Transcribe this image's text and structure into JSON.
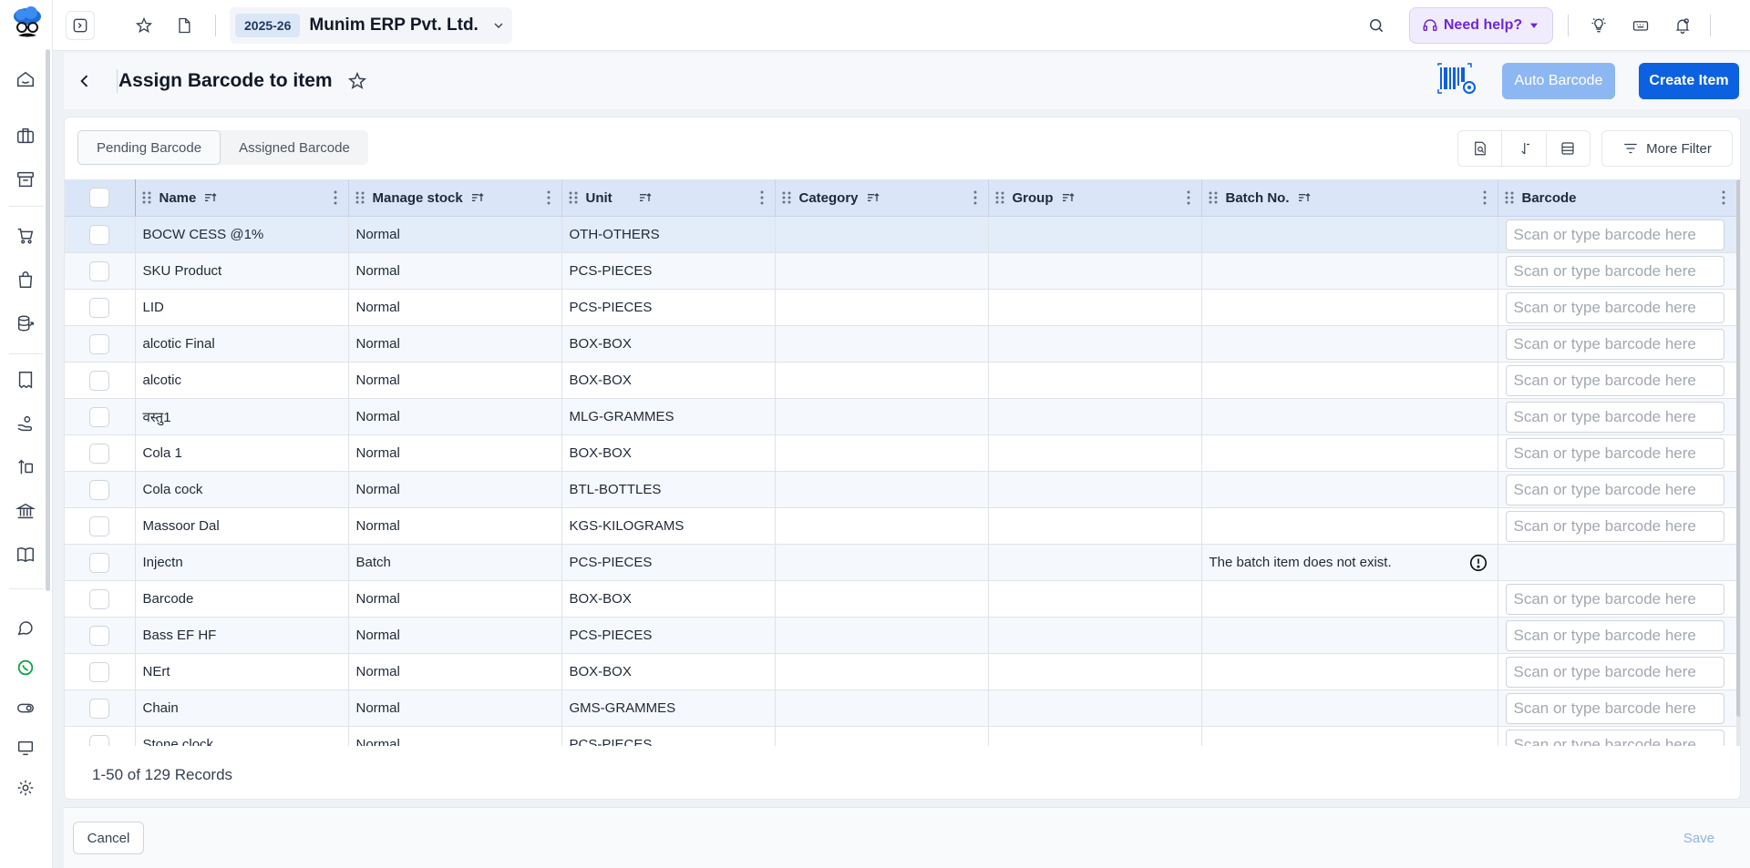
{
  "topbar": {
    "fy": "2025-26",
    "company": "Munim ERP Pvt. Ltd.",
    "help_label": "Need help?"
  },
  "header": {
    "title": "Assign Barcode to item",
    "auto_barcode": "Auto Barcode",
    "create_item": "Create Item"
  },
  "tabs": [
    {
      "label": "Pending Barcode",
      "active": true
    },
    {
      "label": "Assigned Barcode",
      "active": false
    }
  ],
  "more_filter": "More Filter",
  "columns": [
    "Name",
    "Manage stock",
    "Unit",
    "Category",
    "Group",
    "Batch No.",
    "Barcode"
  ],
  "barcode_placeholder": "Scan or type barcode here",
  "rows": [
    {
      "name": "BOCW CESS @1%",
      "stock": "Normal",
      "unit": "OTH-OTHERS",
      "category": "",
      "group": "",
      "batch": ""
    },
    {
      "name": "SKU Product",
      "stock": "Normal",
      "unit": "PCS-PIECES",
      "category": "",
      "group": "",
      "batch": ""
    },
    {
      "name": "LID",
      "stock": "Normal",
      "unit": "PCS-PIECES",
      "category": "",
      "group": "",
      "batch": ""
    },
    {
      "name": "alcotic Final",
      "stock": "Normal",
      "unit": "BOX-BOX",
      "category": "",
      "group": "",
      "batch": ""
    },
    {
      "name": "alcotic",
      "stock": "Normal",
      "unit": "BOX-BOX",
      "category": "",
      "group": "",
      "batch": ""
    },
    {
      "name": "वस्तु1",
      "stock": "Normal",
      "unit": "MLG-GRAMMES",
      "category": "",
      "group": "",
      "batch": ""
    },
    {
      "name": "Cola 1",
      "stock": "Normal",
      "unit": "BOX-BOX",
      "category": "",
      "group": "",
      "batch": ""
    },
    {
      "name": "Cola cock",
      "stock": "Normal",
      "unit": "BTL-BOTTLES",
      "category": "",
      "group": "",
      "batch": ""
    },
    {
      "name": "Massoor Dal",
      "stock": "Normal",
      "unit": "KGS-KILOGRAMS",
      "category": "",
      "group": "",
      "batch": ""
    },
    {
      "name": "Injectn",
      "stock": "Batch",
      "unit": "PCS-PIECES",
      "category": "",
      "group": "",
      "batch": "The batch item does not exist."
    },
    {
      "name": "Barcode",
      "stock": "Normal",
      "unit": "BOX-BOX",
      "category": "",
      "group": "",
      "batch": ""
    },
    {
      "name": "Bass EF HF",
      "stock": "Normal",
      "unit": "PCS-PIECES",
      "category": "",
      "group": "",
      "batch": ""
    },
    {
      "name": "NErt",
      "stock": "Normal",
      "unit": "BOX-BOX",
      "category": "",
      "group": "",
      "batch": ""
    },
    {
      "name": "Chain",
      "stock": "Normal",
      "unit": "GMS-GRAMMES",
      "category": "",
      "group": "",
      "batch": ""
    },
    {
      "name": "Stone clock",
      "stock": "Normal",
      "unit": "PCS-PIECES",
      "category": "",
      "group": "",
      "batch": ""
    }
  ],
  "records": "1-50 of 129 Records",
  "footer": {
    "cancel": "Cancel",
    "save": "Save"
  },
  "colors": {
    "primary": "#0b61e0",
    "header_row": "#dae6f7",
    "help": "#6d28d9"
  }
}
